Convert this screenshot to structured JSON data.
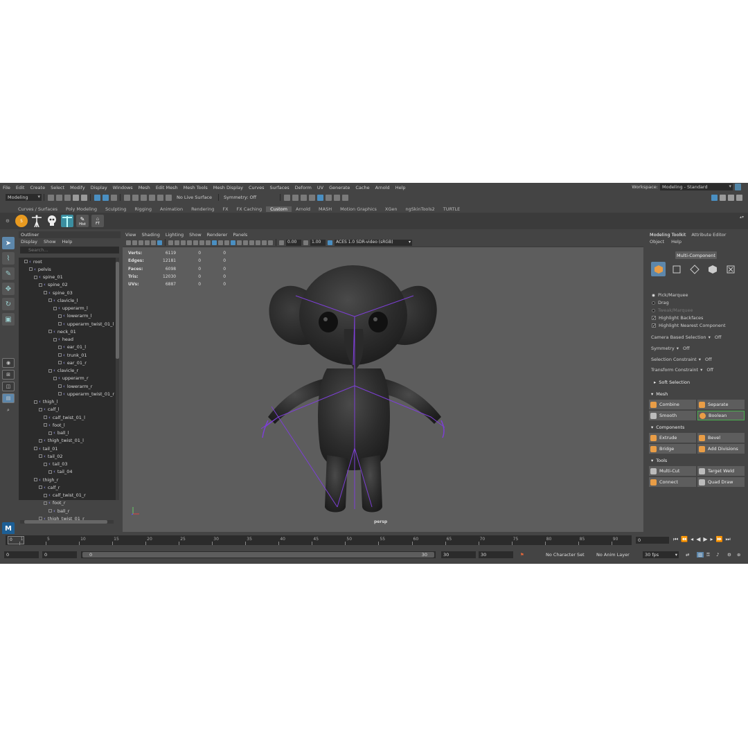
{
  "menus": [
    "File",
    "Edit",
    "Create",
    "Select",
    "Modify",
    "Display",
    "Windows",
    "Mesh",
    "Edit Mesh",
    "Mesh Tools",
    "Mesh Display",
    "Curves",
    "Surfaces",
    "Deform",
    "UV",
    "Generate",
    "Cache",
    "Arnold",
    "Help"
  ],
  "workspace": {
    "label": "Workspace:",
    "value": "Modeling - Standard"
  },
  "status": {
    "menuset": "Modeling",
    "live_surface": "No Live Surface",
    "symmetry": "Symmetry: Off"
  },
  "shelf_tabs": [
    "Curves / Surfaces",
    "Poly Modeling",
    "Sculpting",
    "Rigging",
    "Animation",
    "Rendering",
    "FX",
    "FX Caching",
    "Custom",
    "Arnold",
    "MASH",
    "Motion Graphics",
    "XGen",
    "ngSkinTools2",
    "TURTLE"
  ],
  "shelf_active": "Custom",
  "shelf_buttons": {
    "hist": "Hist",
    "ft": "FT",
    "five": "5"
  },
  "outliner": {
    "title": "Outliner",
    "menu": [
      "Display",
      "Show",
      "Help"
    ],
    "search_placeholder": "Search...",
    "items": [
      {
        "name": "root",
        "depth": 0
      },
      {
        "name": "pelvis",
        "depth": 1
      },
      {
        "name": "spine_01",
        "depth": 2
      },
      {
        "name": "spine_02",
        "depth": 3
      },
      {
        "name": "spine_03",
        "depth": 4
      },
      {
        "name": "clavicle_l",
        "depth": 5
      },
      {
        "name": "upperarm_l",
        "depth": 6
      },
      {
        "name": "lowerarm_l",
        "depth": 7
      },
      {
        "name": "upperarm_twist_01_l",
        "depth": 7
      },
      {
        "name": "neck_01",
        "depth": 5
      },
      {
        "name": "head",
        "depth": 6
      },
      {
        "name": "ear_01_l",
        "depth": 7
      },
      {
        "name": "trunk_01",
        "depth": 7
      },
      {
        "name": "ear_01_r",
        "depth": 7
      },
      {
        "name": "clavicle_r",
        "depth": 5
      },
      {
        "name": "upperarm_r",
        "depth": 6
      },
      {
        "name": "lowerarm_r",
        "depth": 7
      },
      {
        "name": "upperarm_twist_01_r",
        "depth": 7
      },
      {
        "name": "thigh_l",
        "depth": 2
      },
      {
        "name": "calf_l",
        "depth": 3
      },
      {
        "name": "calf_twist_01_l",
        "depth": 4
      },
      {
        "name": "foot_l",
        "depth": 4
      },
      {
        "name": "ball_l",
        "depth": 5
      },
      {
        "name": "thigh_twist_01_l",
        "depth": 3
      },
      {
        "name": "tail_01",
        "depth": 2
      },
      {
        "name": "tail_02",
        "depth": 3
      },
      {
        "name": "tail_03",
        "depth": 4
      },
      {
        "name": "tail_04",
        "depth": 5
      },
      {
        "name": "thigh_r",
        "depth": 2
      },
      {
        "name": "calf_r",
        "depth": 3
      },
      {
        "name": "calf_twist_01_r",
        "depth": 4
      },
      {
        "name": "foot_r",
        "depth": 4
      },
      {
        "name": "ball_r",
        "depth": 5
      },
      {
        "name": "thigh_twist_01_r",
        "depth": 3
      }
    ]
  },
  "viewport": {
    "menu": [
      "View",
      "Shading",
      "Lighting",
      "Show",
      "Renderer",
      "Panels"
    ],
    "exposure": "0.00",
    "gamma": "1.00",
    "colorspace": "ACES 1.0 SDR-video (sRGB)",
    "camera": "persp",
    "hud": [
      {
        "label": "Verts:",
        "v1": "6119",
        "v2": "0",
        "v3": "0"
      },
      {
        "label": "Edges:",
        "v1": "12181",
        "v2": "0",
        "v3": "0"
      },
      {
        "label": "Faces:",
        "v1": "6098",
        "v2": "0",
        "v3": "0"
      },
      {
        "label": "Tris:",
        "v1": "12030",
        "v2": "0",
        "v3": "0"
      },
      {
        "label": "UVs:",
        "v1": "6887",
        "v2": "0",
        "v3": "0"
      }
    ]
  },
  "toolkit": {
    "tabs": [
      "Modeling Toolkit",
      "Attribute Editor"
    ],
    "menu": [
      "Object",
      "Help"
    ],
    "multi": "Multi-Component",
    "pick": "Pick/Marquee",
    "drag": "Drag",
    "tweak": "Tweak/Marquee",
    "backfaces": "Highlight Backfaces",
    "nearest": "Highlight Nearest Component",
    "camera_sel": {
      "label": "Camera Based Selection",
      "value": "Off"
    },
    "symmetry": {
      "label": "Symmetry",
      "value": "Off"
    },
    "sel_constraint": {
      "label": "Selection Constraint",
      "value": "Off"
    },
    "xform_constraint": {
      "label": "Transform Constraint",
      "value": "Off"
    },
    "soft": "Soft Selection",
    "mesh": "Mesh",
    "components": "Components",
    "tools": "Tools",
    "buttons": {
      "combine": "Combine",
      "separate": "Separate",
      "smooth": "Smooth",
      "boolean": "Boolean",
      "extrude": "Extrude",
      "bevel": "Bevel",
      "bridge": "Bridge",
      "add_divisions": "Add Divisions",
      "multicut": "Multi-Cut",
      "target_weld": "Target Weld",
      "connect": "Connect",
      "quad_draw": "Quad Draw"
    }
  },
  "timeline": {
    "ticks": [
      "1",
      "5",
      "10",
      "15",
      "20",
      "25",
      "30",
      "35",
      "40",
      "45",
      "50",
      "55",
      "60",
      "65",
      "70",
      "75",
      "80",
      "85",
      "90"
    ],
    "tick_values": [
      1,
      5,
      10,
      15,
      20,
      25,
      30,
      35,
      40,
      45,
      50,
      55,
      60,
      65,
      70,
      75,
      80,
      85,
      90
    ],
    "current_frame_box": "0",
    "current_frame": "0"
  },
  "range": {
    "start": "0",
    "anim_start": "0",
    "slider_start": "0",
    "slider_end": "30",
    "anim_end": "30",
    "end": "30",
    "character_set": "No Character Set",
    "anim_layer": "No Anim Layer",
    "fps": "30 fps"
  },
  "colors": {
    "accent": "#5d87ab",
    "joint": "#7d3fd6",
    "mesh": "#2f2f2f"
  }
}
